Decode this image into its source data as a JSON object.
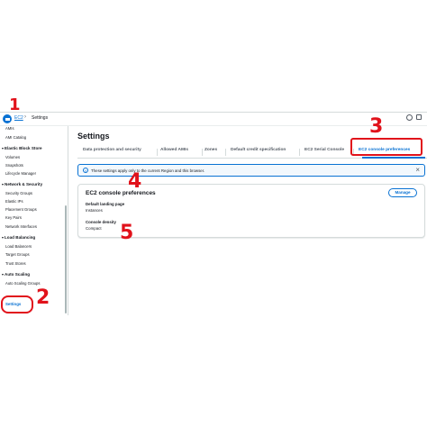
{
  "breadcrumb": {
    "root": "EC2",
    "separator": "›",
    "current": "Settings"
  },
  "sidebar": {
    "items": [
      {
        "label": "AMIs",
        "kind": "item"
      },
      {
        "label": "AMI Catalog",
        "kind": "item"
      },
      {
        "label": "Elastic Block Store",
        "kind": "header"
      },
      {
        "label": "Volumes",
        "kind": "item"
      },
      {
        "label": "Snapshots",
        "kind": "item"
      },
      {
        "label": "Lifecycle Manager",
        "kind": "item"
      },
      {
        "label": "Network & Security",
        "kind": "header"
      },
      {
        "label": "Security Groups",
        "kind": "item"
      },
      {
        "label": "Elastic IPs",
        "kind": "item"
      },
      {
        "label": "Placement Groups",
        "kind": "item"
      },
      {
        "label": "Key Pairs",
        "kind": "item"
      },
      {
        "label": "Network Interfaces",
        "kind": "item"
      },
      {
        "label": "Load Balancing",
        "kind": "header"
      },
      {
        "label": "Load Balancers",
        "kind": "item"
      },
      {
        "label": "Target Groups",
        "kind": "item"
      },
      {
        "label": "Trust Stores",
        "kind": "item"
      },
      {
        "label": "Auto Scaling",
        "kind": "header"
      },
      {
        "label": "Auto Scaling Groups",
        "kind": "item"
      }
    ],
    "active": "Settings"
  },
  "page": {
    "title": "Settings"
  },
  "tabs": [
    "Data protection and security",
    "Allowed AMIs",
    "Zones",
    "Default credit specification",
    "EC2 Serial Console",
    "EC2 console preferences"
  ],
  "active_tab": "EC2 console preferences",
  "flash": {
    "icon": "info-icon",
    "text": "These settings apply only to the current Region and this browser.",
    "close": "×"
  },
  "card": {
    "title": "EC2 console preferences",
    "manage_label": "Manage",
    "fields": [
      {
        "label": "Default landing page",
        "value": "Instances"
      },
      {
        "label": "Console density",
        "value": "Compact"
      }
    ]
  },
  "annotations": {
    "n1": "1",
    "n2": "2",
    "n3": "3",
    "n4": "4",
    "n5": "5"
  },
  "colors": {
    "accent": "#0972d3",
    "annotation": "#e1121b",
    "border": "#d5dbdb"
  }
}
